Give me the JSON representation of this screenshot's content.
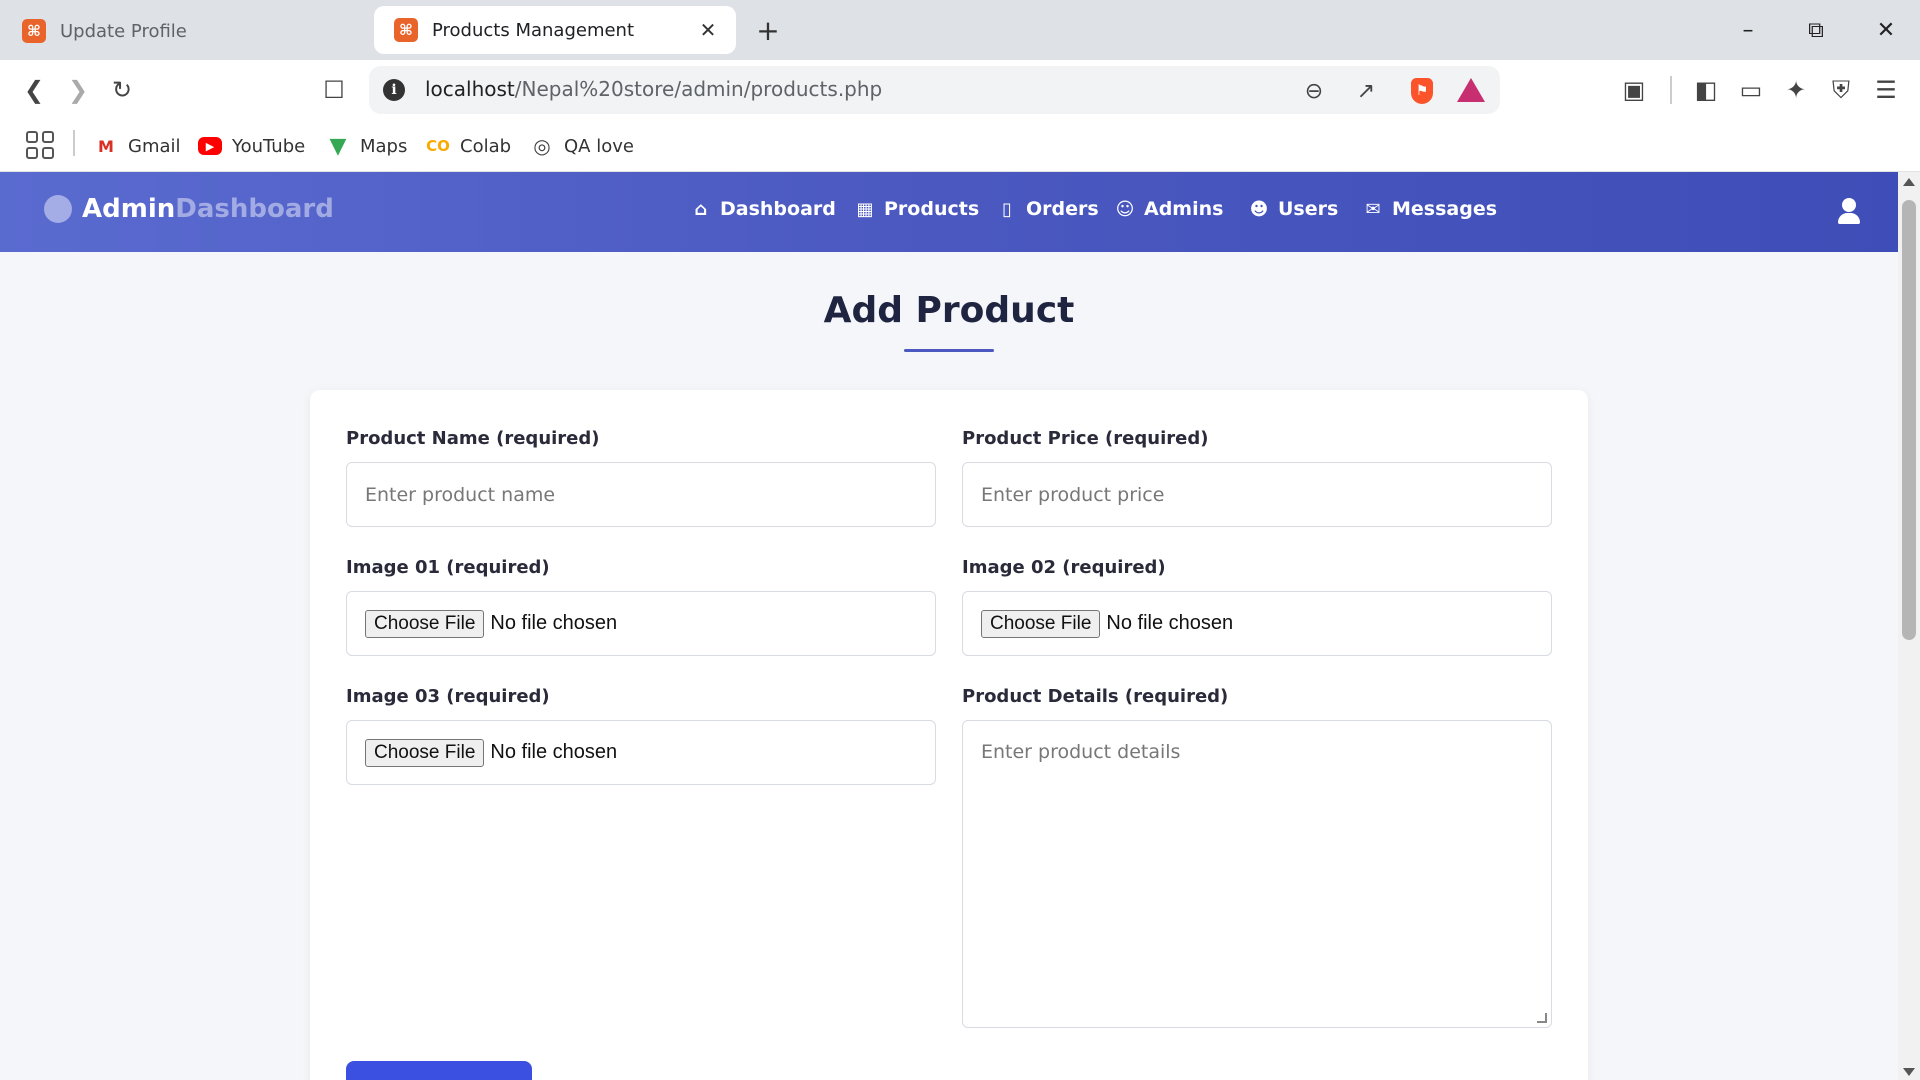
{
  "browser": {
    "tabs": [
      {
        "title": "Update Profile",
        "favicon": "xampp-icon",
        "active": false
      },
      {
        "title": "Products Management",
        "favicon": "xampp-icon",
        "active": true
      }
    ],
    "url_host": "localhost",
    "url_path": "/Nepal%20store/admin/products.php",
    "notification_count": "1",
    "bookmarks": [
      {
        "label": "Gmail",
        "icon": "gmail-icon"
      },
      {
        "label": "YouTube",
        "icon": "youtube-icon"
      },
      {
        "label": "Maps",
        "icon": "maps-icon"
      },
      {
        "label": "Colab",
        "icon": "colab-icon"
      },
      {
        "label": "QA love",
        "icon": "globe-icon"
      }
    ]
  },
  "app": {
    "logo_primary": "Admin",
    "logo_secondary": "Dashboard",
    "nav": [
      {
        "label": "Dashboard",
        "icon": "home-icon"
      },
      {
        "label": "Products",
        "icon": "boxes-icon"
      },
      {
        "label": "Orders",
        "icon": "clipboard-icon"
      },
      {
        "label": "Admins",
        "icon": "user-cog-icon"
      },
      {
        "label": "Users",
        "icon": "users-icon"
      },
      {
        "label": "Messages",
        "icon": "envelope-icon"
      }
    ],
    "colors": {
      "navbar": "#4a58c0",
      "accent": "#3b4fe0",
      "heading": "#1f2540"
    }
  },
  "form": {
    "heading": "Add Product",
    "name_label": "Product Name (required)",
    "name_placeholder": "Enter product name",
    "price_label": "Product Price (required)",
    "price_placeholder": "Enter product price",
    "image1_label": "Image 01 (required)",
    "image2_label": "Image 02 (required)",
    "image3_label": "Image 03 (required)",
    "choose_file": "Choose File",
    "no_file": "No file chosen",
    "details_label": "Product Details (required)",
    "details_placeholder": "Enter product details"
  }
}
